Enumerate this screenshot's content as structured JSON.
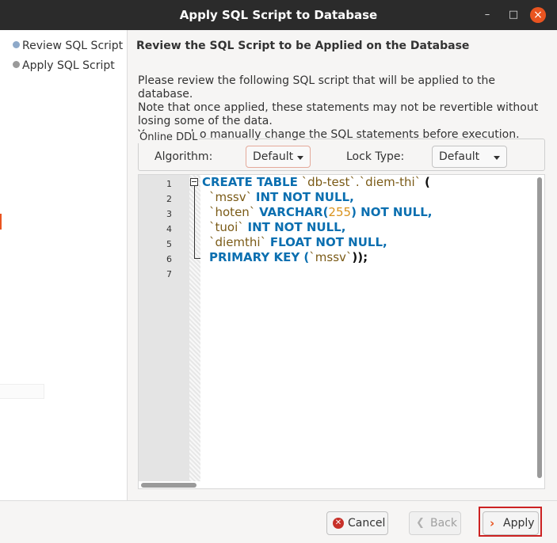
{
  "window": {
    "title": "Apply SQL Script to Database",
    "minimize": "–",
    "maximize": "□",
    "close": "×"
  },
  "sidebar": {
    "steps": [
      {
        "label": "Review SQL Script",
        "active": true
      },
      {
        "label": "Apply SQL Script",
        "active": false
      }
    ]
  },
  "main": {
    "heading": "Review the SQL Script to be Applied on the Database",
    "description": [
      "Please review the following SQL script that will be applied to the database.",
      "Note that once applied, these statements may not be revertible without",
      "losing some of the data.",
      "You can also manually change the SQL statements before execution."
    ],
    "online_ddl": {
      "legend": "Online DDL",
      "algorithm_label": "Algorithm:",
      "algorithm_value": "Default",
      "lock_type_label": "Lock Type:",
      "lock_type_value": "Default"
    }
  },
  "editor": {
    "line_numbers": [
      "1",
      "2",
      "3",
      "4",
      "5",
      "6",
      "7"
    ],
    "tokens": {
      "create_table": "CREATE TABLE",
      "table_name": "`db-test`.`diem-thi`",
      "open_paren": "(",
      "col_mssv": "`mssv`",
      "int_not_null": "INT NOT NULL,",
      "col_hoten": "`hoten`",
      "varchar": "VARCHAR(",
      "len_255": "255",
      "close_not_null": ") NOT NULL,",
      "col_tuoi": "`tuoi`",
      "col_diemthi": "`diemthi`",
      "float_not_null": "FLOAT NOT NULL,",
      "primary_key": "PRIMARY KEY (",
      "pk_col": "`mssv`",
      "end": "));"
    }
  },
  "footer": {
    "cancel_label": "Cancel",
    "back_label": "Back",
    "apply_label": "Apply"
  },
  "colors": {
    "accent": "#e95420",
    "keyword": "#0b6fb0",
    "identifier": "#7a5a16",
    "number": "#d9921c",
    "highlight_frame": "#cc2222"
  }
}
